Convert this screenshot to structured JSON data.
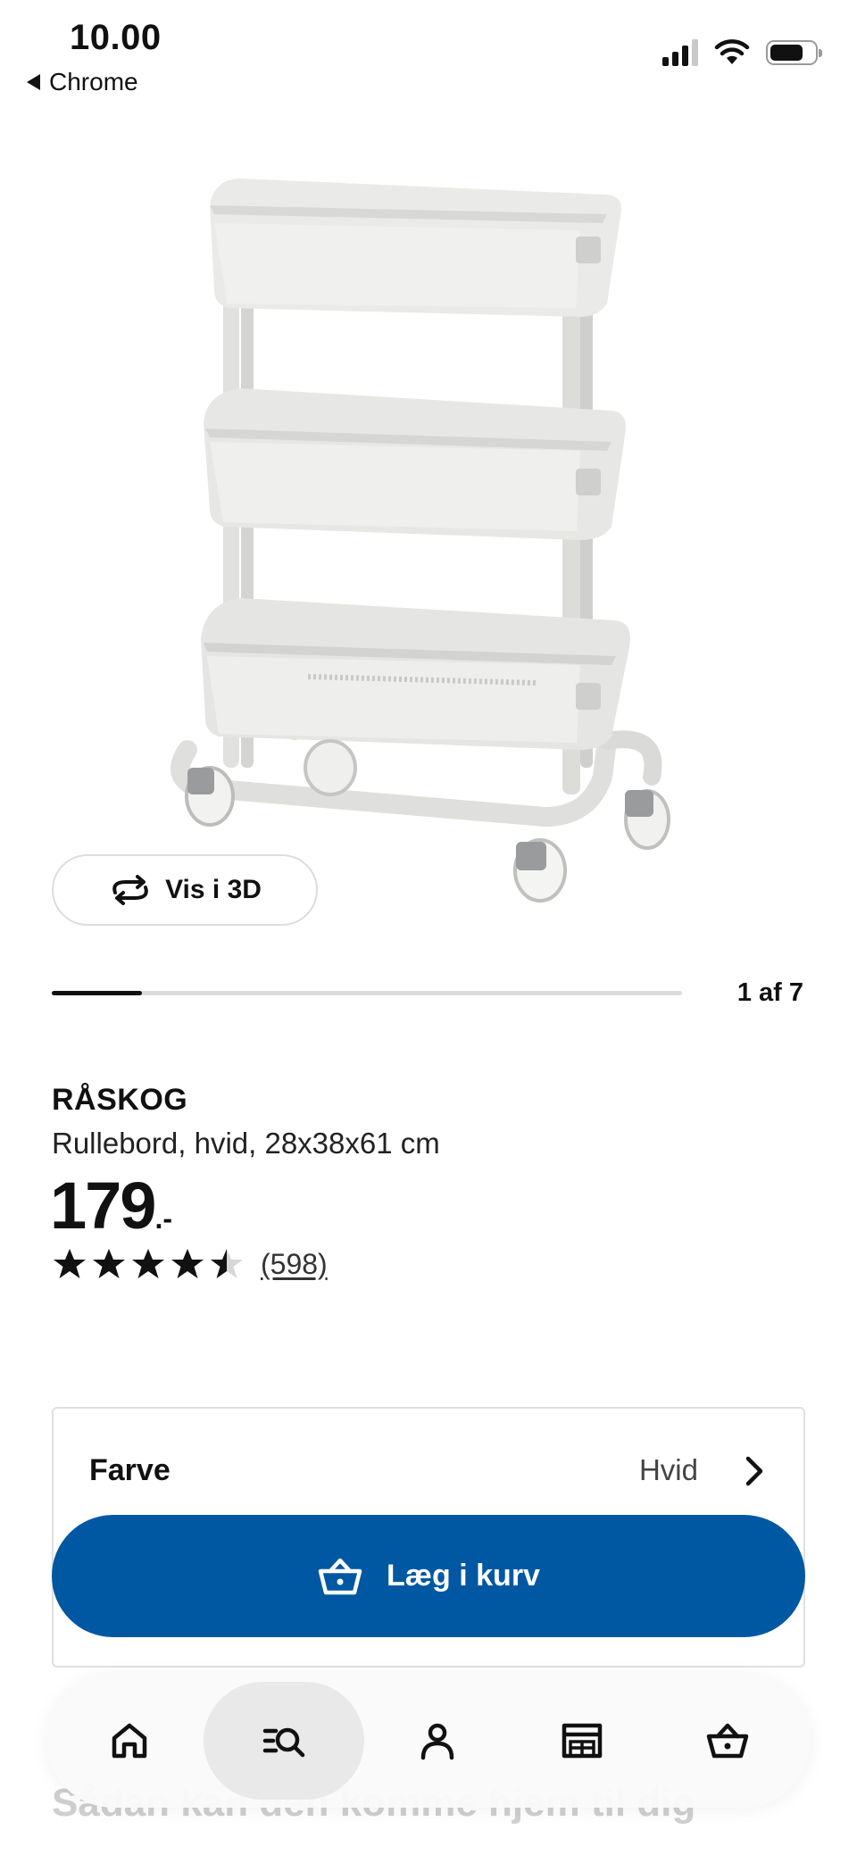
{
  "status_bar": {
    "time": "10.00",
    "back_app": "Chrome",
    "signal_bars_active": 3,
    "signal_bars_total": 4,
    "battery_level": 0.75
  },
  "gallery": {
    "view_3d_label": "Vis i 3D",
    "counter": "1 af 7",
    "current": 1,
    "total": 7
  },
  "product": {
    "name": "RÅSKOG",
    "description": "Rullebord, hvid, 28x38x61 cm",
    "price_main": "179",
    "price_suffix": ".-",
    "rating_value": 4.5,
    "rating_max": 5,
    "review_count": "(598)"
  },
  "color_option": {
    "label": "Farve",
    "value": "Hvid"
  },
  "cart_button": {
    "label": "Læg i kurv",
    "color": "#0058a3"
  },
  "behind_text": "Sådan kan den komme hjem til dig",
  "nav": {
    "items": [
      {
        "name": "home",
        "icon": "home-icon"
      },
      {
        "name": "search",
        "icon": "search-list-icon",
        "active": true
      },
      {
        "name": "profile",
        "icon": "person-icon"
      },
      {
        "name": "store",
        "icon": "store-icon"
      },
      {
        "name": "cart",
        "icon": "basket-icon"
      }
    ]
  }
}
